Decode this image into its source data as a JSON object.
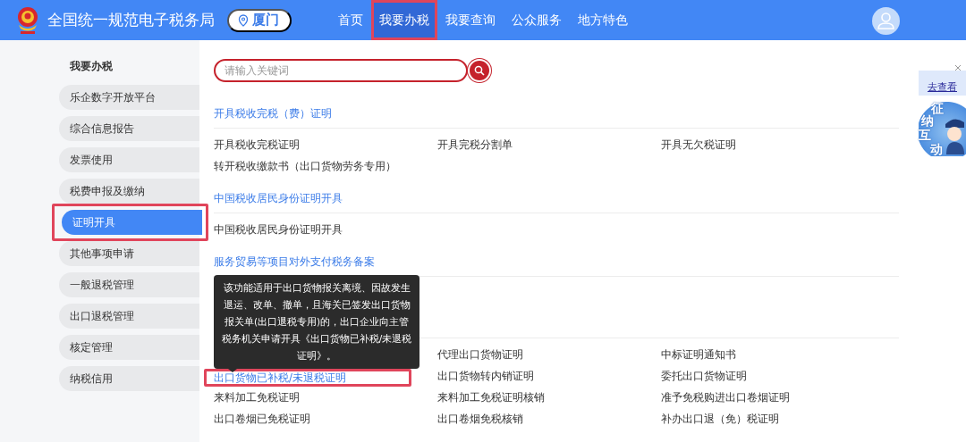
{
  "header": {
    "site_title": "全国统一规范电子税务局",
    "location": "厦门",
    "nav": [
      {
        "label": "首页",
        "selected": false,
        "annotated": false
      },
      {
        "label": "我要办税",
        "selected": true,
        "annotated": true
      },
      {
        "label": "我要查询",
        "selected": false,
        "annotated": false
      },
      {
        "label": "公众服务",
        "selected": false,
        "annotated": false
      },
      {
        "label": "地方特色",
        "selected": false,
        "annotated": false
      }
    ]
  },
  "sidebar": {
    "heading": "我要办税",
    "items": [
      {
        "label": "乐企数字开放平台",
        "selected": false,
        "annotated": false
      },
      {
        "label": "综合信息报告",
        "selected": false,
        "annotated": false
      },
      {
        "label": "发票使用",
        "selected": false,
        "annotated": false
      },
      {
        "label": "税费申报及缴纳",
        "selected": false,
        "annotated": false
      },
      {
        "label": "证明开具",
        "selected": true,
        "annotated": true
      },
      {
        "label": "其他事项申请",
        "selected": false,
        "annotated": false
      },
      {
        "label": "一般退税管理",
        "selected": false,
        "annotated": false
      },
      {
        "label": "出口退税管理",
        "selected": false,
        "annotated": false
      },
      {
        "label": "核定管理",
        "selected": false,
        "annotated": false
      },
      {
        "label": "纳税信用",
        "selected": false,
        "annotated": false
      }
    ]
  },
  "search": {
    "placeholder": "请输入关键词"
  },
  "sections": [
    {
      "title": "开具税收完税（费）证明",
      "items": [
        {
          "kind": "text",
          "label": "开具税收完税证明",
          "annotated": false
        },
        {
          "kind": "text",
          "label": "开具完税分割单",
          "annotated": false
        },
        {
          "kind": "text",
          "label": "开具无欠税证明",
          "annotated": false
        },
        {
          "kind": "text",
          "label": "转开税收缴款书（出口货物劳务专用）",
          "annotated": false
        }
      ]
    },
    {
      "title": "中国税收居民身份证明开具",
      "items": [
        {
          "kind": "text",
          "label": "中国税收居民身份证明开具",
          "annotated": false
        }
      ]
    },
    {
      "title": "服务贸易等项目对外支付税务备案"
    },
    {
      "items": [
        {
          "kind": "covered"
        },
        {
          "kind": "text",
          "label": "代理出口货物证明",
          "annotated": false
        },
        {
          "kind": "text",
          "label": "中标证明通知书",
          "annotated": false
        },
        {
          "kind": "link",
          "label": "出口货物已补税/未退税证明",
          "annotated": true
        },
        {
          "kind": "text",
          "label": "出口货物转内销证明",
          "annotated": false
        },
        {
          "kind": "text",
          "label": "委托出口货物证明",
          "annotated": false
        },
        {
          "kind": "text",
          "label": "来料加工免税证明",
          "annotated": false
        },
        {
          "kind": "text",
          "label": "来料加工免税证明核销",
          "annotated": false
        },
        {
          "kind": "text",
          "label": "准予免税购进出口卷烟证明",
          "annotated": false
        },
        {
          "kind": "text",
          "label": "出口卷烟已免税证明",
          "annotated": false
        },
        {
          "kind": "text",
          "label": "出口卷烟免税核销",
          "annotated": false
        },
        {
          "kind": "text",
          "label": "补办出口退（免）税证明",
          "annotated": false
        }
      ]
    }
  ],
  "tooltip": "该功能适用于出口货物报关离境、因故发生退运、改单、撤单，且海关已签发出口货物报关单(出口退税专用)的，出口企业向主管税务机关申请开具《出口货物已补税/未退税证明》。",
  "side_widget": {
    "notice_link": "去查看",
    "badge_chars": [
      "征",
      "纳",
      "互",
      "动"
    ]
  }
}
